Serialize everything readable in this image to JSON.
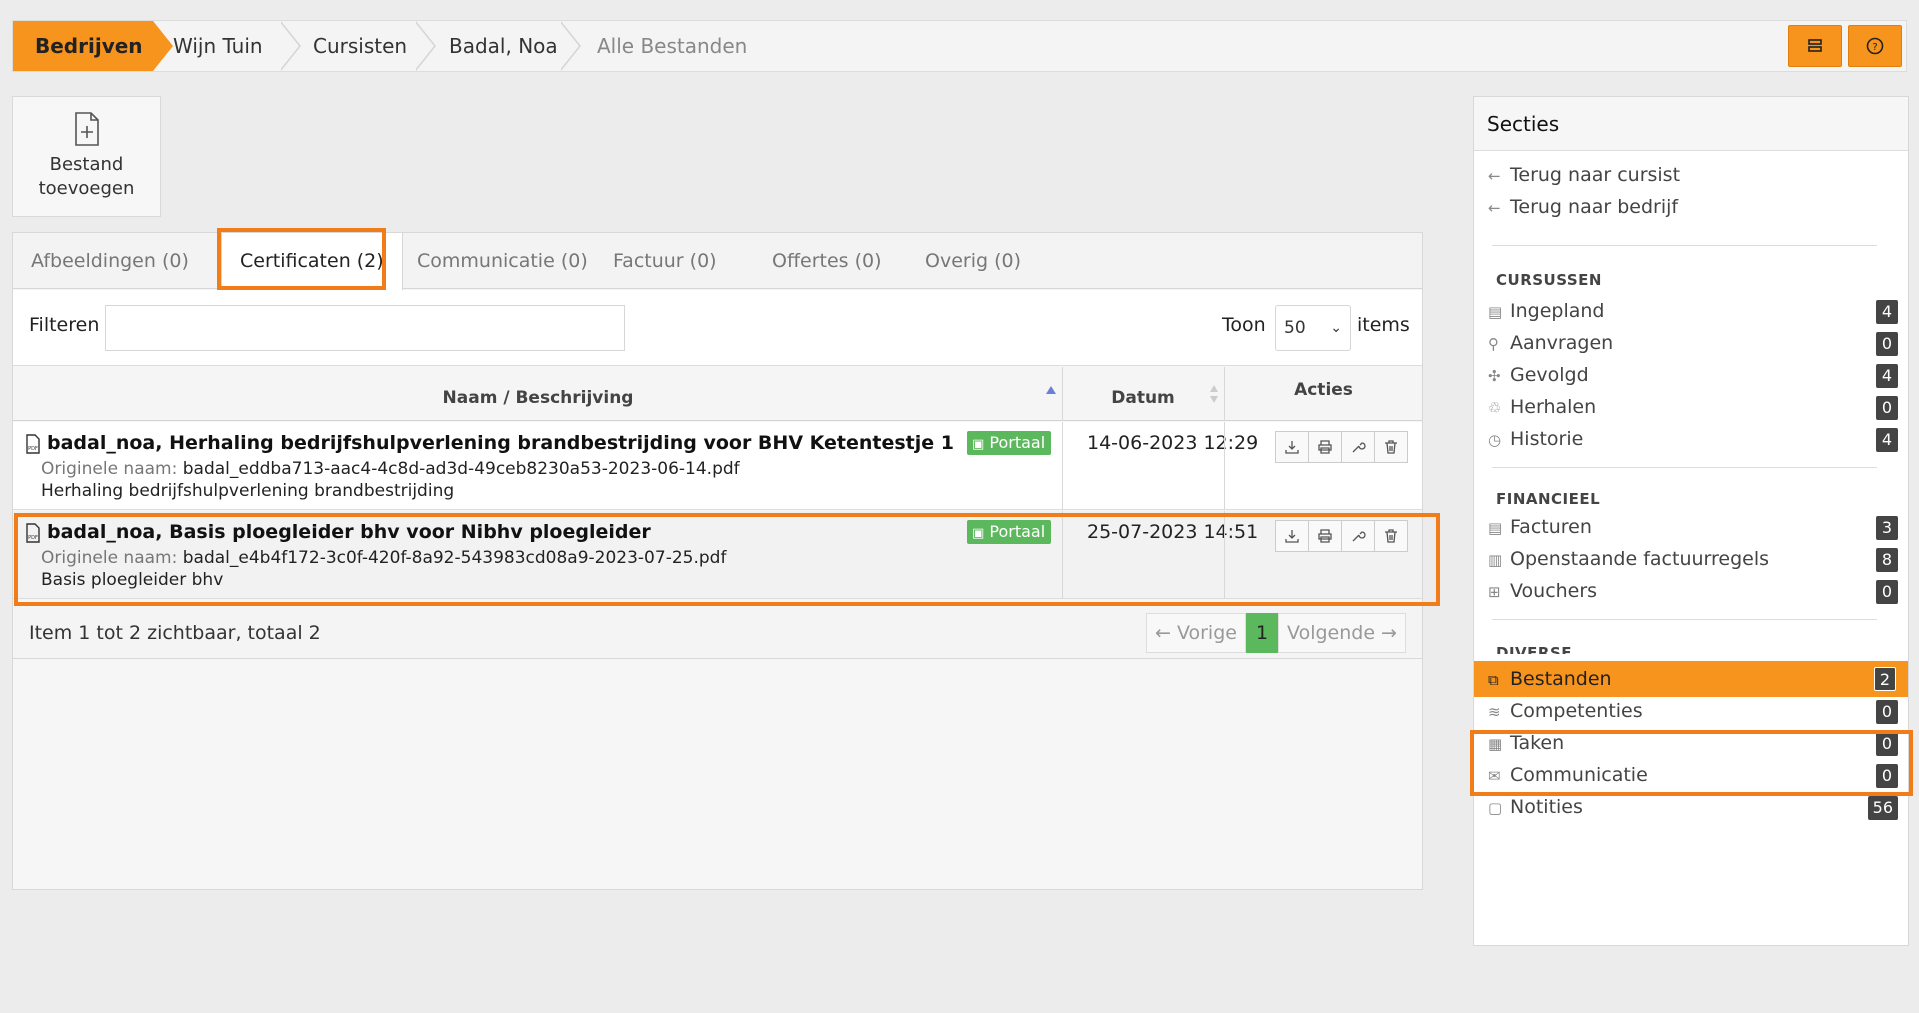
{
  "breadcrumb": {
    "items": [
      "Bedrijven",
      "Wijn Tuin",
      "Cursisten",
      "Badal, Noa",
      "Alle Bestanden"
    ]
  },
  "toolbar": {
    "add_file_label_1": "Bestand",
    "add_file_label_2": "toevoegen"
  },
  "tabs": [
    {
      "label": "Afbeeldingen (0)"
    },
    {
      "label": "Certificaten (2)"
    },
    {
      "label": "Communicatie (0)"
    },
    {
      "label": "Factuur (0)"
    },
    {
      "label": "Offertes (0)"
    },
    {
      "label": "Overig (0)"
    }
  ],
  "filter": {
    "label": "Filteren",
    "value": "",
    "show_label": "Toon",
    "page_size": "50",
    "items_label": "items"
  },
  "table": {
    "headers": {
      "name": "Naam / Beschrijving",
      "date": "Datum",
      "actions": "Acties"
    },
    "original_label": "Originele naam:",
    "badge": "Portaal",
    "rows": [
      {
        "title": "badal_noa, Herhaling bedrijfshulpverlening brandbestrijding voor BHV Ketentestje 1",
        "original": "badal_eddba713-aac4-4c8d-ad3d-49ceb8230a53-2023-06-14.pdf",
        "description": "Herhaling bedrijfshulpverlening brandbestrijding",
        "date": "14-06-2023 12:29"
      },
      {
        "title": "badal_noa, Basis ploegleider bhv voor Nibhv ploegleider",
        "original": "badal_e4b4f172-3c0f-420f-8a92-543983cd08a9-2023-07-25.pdf",
        "description": "Basis ploegleider bhv",
        "date": "25-07-2023 14:51"
      }
    ],
    "summary": "Item 1 tot 2 zichtbaar, totaal 2",
    "pager": {
      "prev": "← Vorige",
      "current": "1",
      "next": "Volgende →"
    }
  },
  "sidebar": {
    "title": "Secties",
    "back_links": [
      "Terug naar cursist",
      "Terug naar bedrijf"
    ],
    "groups": {
      "cursussen": "CURSUSSEN",
      "financieel": "FINANCIEEL",
      "diverse": "DIVERSE"
    },
    "cursussen": [
      {
        "label": "Ingepland",
        "count": "4"
      },
      {
        "label": "Aanvragen",
        "count": "0"
      },
      {
        "label": "Gevolgd",
        "count": "4"
      },
      {
        "label": "Herhalen",
        "count": "0"
      },
      {
        "label": "Historie",
        "count": "4"
      }
    ],
    "financieel": [
      {
        "label": "Facturen",
        "count": "3"
      },
      {
        "label": "Openstaande factuurregels",
        "count": "8"
      },
      {
        "label": "Vouchers",
        "count": "0"
      }
    ],
    "diverse": [
      {
        "label": "Bestanden",
        "count": "2"
      },
      {
        "label": "Competenties",
        "count": "0"
      },
      {
        "label": "Taken",
        "count": "0"
      },
      {
        "label": "Communicatie",
        "count": "0"
      },
      {
        "label": "Notities",
        "count": "56"
      }
    ]
  },
  "colors": {
    "accent": "#f7941d",
    "highlight": "#f07c1a",
    "badge": "#5cb85c"
  }
}
